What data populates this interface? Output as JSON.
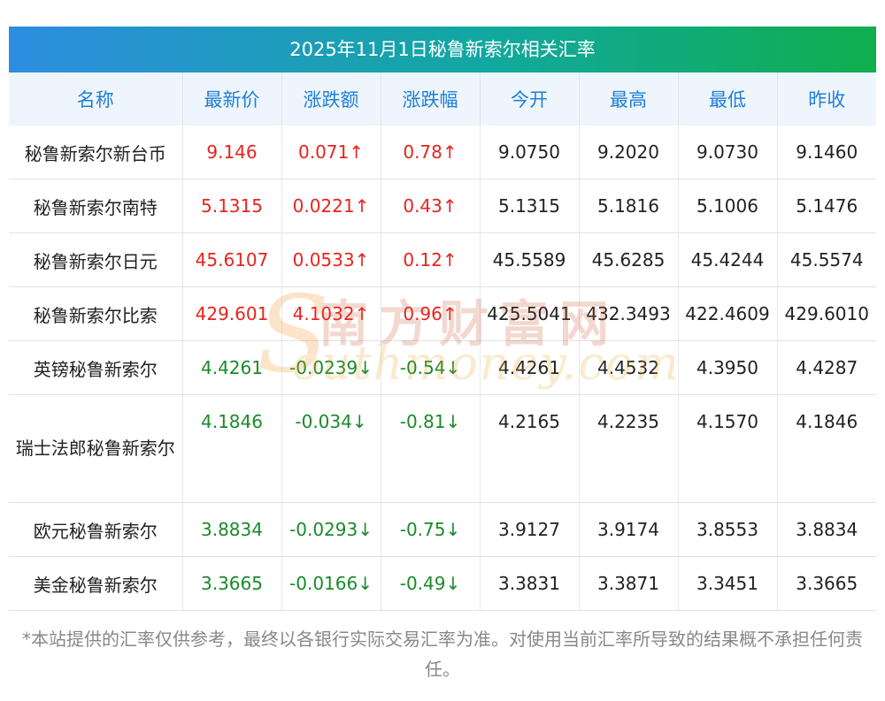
{
  "title": "2025年11月1日秘鲁新索尔相关汇率",
  "columns": [
    "名称",
    "最新价",
    "涨跌额",
    "涨跌幅",
    "今开",
    "最高",
    "最低",
    "昨收"
  ],
  "rows": [
    {
      "name": "秘鲁新索尔新台币",
      "latest": "9.146",
      "change": "0.071↑",
      "pct": "0.78↑",
      "open": "9.0750",
      "high": "9.2020",
      "low": "9.0730",
      "prev": "9.1460",
      "dir": "up"
    },
    {
      "name": "秘鲁新索尔南特",
      "latest": "5.1315",
      "change": "0.0221↑",
      "pct": "0.43↑",
      "open": "5.1315",
      "high": "5.1816",
      "low": "5.1006",
      "prev": "5.1476",
      "dir": "up"
    },
    {
      "name": "秘鲁新索尔日元",
      "latest": "45.6107",
      "change": "0.0533↑",
      "pct": "0.12↑",
      "open": "45.5589",
      "high": "45.6285",
      "low": "45.4244",
      "prev": "45.5574",
      "dir": "up"
    },
    {
      "name": "秘鲁新索尔比索",
      "latest": "429.601",
      "change": "4.1032↑",
      "pct": "0.96↑",
      "open": "425.5041",
      "high": "432.3493",
      "low": "422.4609",
      "prev": "429.6010",
      "dir": "up"
    },
    {
      "name": "英镑秘鲁新索尔",
      "latest": "4.4261",
      "change": "-0.0239↓",
      "pct": "-0.54↓",
      "open": "4.4261",
      "high": "4.4532",
      "low": "4.3950",
      "prev": "4.4287",
      "dir": "down"
    },
    {
      "name": "瑞士法郎秘鲁新索尔",
      "latest": "4.1846",
      "change": "-0.034↓",
      "pct": "-0.81↓",
      "open": "4.2165",
      "high": "4.2235",
      "low": "4.1570",
      "prev": "4.1846",
      "dir": "down"
    },
    {
      "name": "欧元秘鲁新索尔",
      "latest": "3.8834",
      "change": "-0.0293↓",
      "pct": "-0.75↓",
      "open": "3.9127",
      "high": "3.9174",
      "low": "3.8553",
      "prev": "3.8834",
      "dir": "down"
    },
    {
      "name": "美金秘鲁新索尔",
      "latest": "3.3665",
      "change": "-0.0166↓",
      "pct": "-0.49↓",
      "open": "3.3831",
      "high": "3.3871",
      "low": "3.3451",
      "prev": "3.3665",
      "dir": "down"
    }
  ],
  "watermark": {
    "cn": "南方财富网",
    "en": "outhmoney.com",
    "s": "S"
  },
  "colors": {
    "up": "#e8231e",
    "down": "#1a8a2a",
    "header_text": "#1f7fd6",
    "title_gradient_start": "#2d8de0",
    "title_gradient_end": "#0fae4e"
  },
  "footnote": "*本站提供的汇率仅供参考，最终以各银行实际交易汇率为准。对使用当前汇率所导致的结果概不承担任何责任。"
}
